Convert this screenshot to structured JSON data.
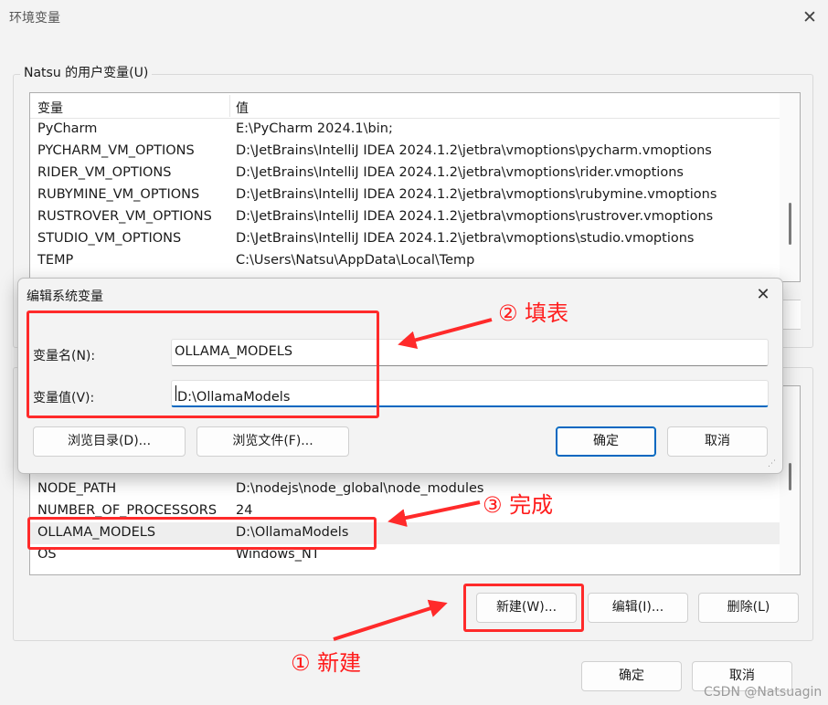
{
  "window": {
    "title": "环境变量",
    "close_glyph": "✕"
  },
  "user_vars": {
    "label": "Natsu 的用户变量(U)",
    "col_variable": "变量",
    "col_value": "值",
    "rows": [
      {
        "name": "PyCharm",
        "value": "E:\\PyCharm 2024.1\\bin;"
      },
      {
        "name": "PYCHARM_VM_OPTIONS",
        "value": "D:\\JetBrains\\IntelliJ IDEA 2024.1.2\\jetbra\\vmoptions\\pycharm.vmoptions"
      },
      {
        "name": "RIDER_VM_OPTIONS",
        "value": "D:\\JetBrains\\IntelliJ IDEA 2024.1.2\\jetbra\\vmoptions\\rider.vmoptions"
      },
      {
        "name": "RUBYMINE_VM_OPTIONS",
        "value": "D:\\JetBrains\\IntelliJ IDEA 2024.1.2\\jetbra\\vmoptions\\rubymine.vmoptions"
      },
      {
        "name": "RUSTROVER_VM_OPTIONS",
        "value": "D:\\JetBrains\\IntelliJ IDEA 2024.1.2\\jetbra\\vmoptions\\rustrover.vmoptions"
      },
      {
        "name": "STUDIO_VM_OPTIONS",
        "value": "D:\\JetBrains\\IntelliJ IDEA 2024.1.2\\jetbra\\vmoptions\\studio.vmoptions"
      },
      {
        "name": "TEMP",
        "value": "C:\\Users\\Natsu\\AppData\\Local\\Temp"
      }
    ]
  },
  "system_vars": {
    "rows": [
      {
        "name": "NODE_PATH",
        "value": "D:\\nodejs\\node_global\\node_modules"
      },
      {
        "name": "NUMBER_OF_PROCESSORS",
        "value": "24"
      },
      {
        "name": "OLLAMA_MODELS",
        "value": "D:\\OllamaModels"
      },
      {
        "name": "OS",
        "value": "Windows_NT"
      }
    ],
    "buttons": {
      "new": "新建(W)...",
      "edit": "编辑(I)...",
      "delete": "删除(L)"
    }
  },
  "footer": {
    "ok": "确定",
    "cancel": "取消"
  },
  "dialog": {
    "title": "编辑系统变量",
    "close_glyph": "✕",
    "name_label": "变量名(N):",
    "name_value": "OLLAMA_MODELS",
    "value_label": "变量值(V):",
    "value_value": "D:\\OllamaModels",
    "browse_dir": "浏览目录(D)...",
    "browse_file": "浏览文件(F)...",
    "ok": "确定",
    "cancel": "取消"
  },
  "annotations": {
    "step1": "① 新建",
    "step2": "② 填表",
    "step3": "③ 完成",
    "color": "#ff2a2a"
  },
  "watermark": "CSDN @Natsuagin"
}
